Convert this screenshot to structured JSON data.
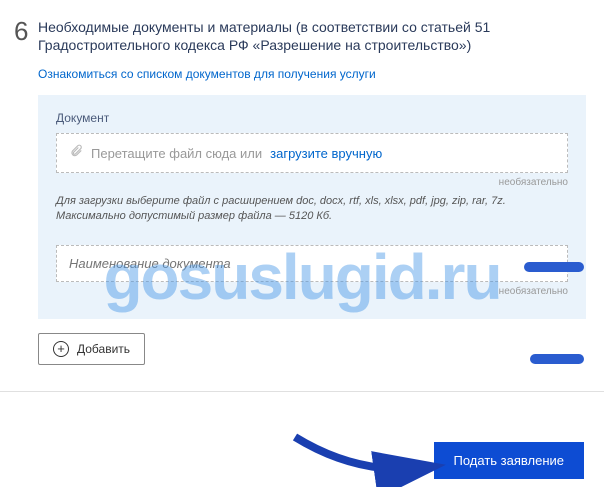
{
  "step_number": "6",
  "title": "Необходимые документы и материалы (в соответствии со статьей 51 Градостроительного кодекса РФ «Разрешение на строительство»)",
  "docs_link": "Ознакомиться со списком документов для получения услуги",
  "panel": {
    "label": "Документ",
    "dropzone_text": "Перетащите файл сюда или",
    "dropzone_link": "загрузите вручную",
    "optional": "необязательно",
    "hint": "Для загрузки выберите файл с расширением doc, docx, rtf, xls, xlsx, pdf, jpg, zip, rar, 7z. Максимально допустимый размер файла — 5120 Кб.",
    "name_placeholder": "Наименование документа"
  },
  "add_button": "Добавить",
  "submit_button": "Подать заявление",
  "watermark": "gosuslugid.ru"
}
